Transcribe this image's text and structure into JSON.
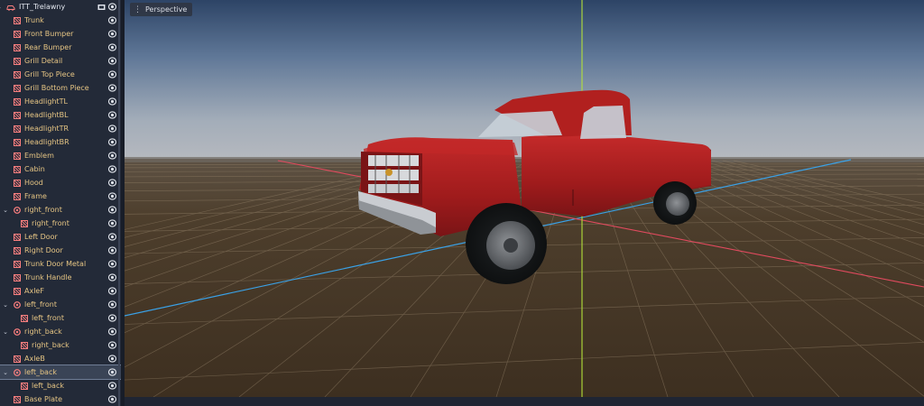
{
  "scene_tree": {
    "root": {
      "label": "ITT_Trelawny",
      "icon": "vehicle-body-icon"
    },
    "nodes": [
      {
        "label": "Trunk",
        "icon": "mesh-instance-icon",
        "depth": 1
      },
      {
        "label": "Front Bumper",
        "icon": "mesh-instance-icon",
        "depth": 1
      },
      {
        "label": "Rear Bumper",
        "icon": "mesh-instance-icon",
        "depth": 1
      },
      {
        "label": "Grill Detail",
        "icon": "mesh-instance-icon",
        "depth": 1
      },
      {
        "label": "Grill Top Piece",
        "icon": "mesh-instance-icon",
        "depth": 1
      },
      {
        "label": "Grill Bottom Piece",
        "icon": "mesh-instance-icon",
        "depth": 1
      },
      {
        "label": "HeadlightTL",
        "icon": "mesh-instance-icon",
        "depth": 1
      },
      {
        "label": "HeadlightBL",
        "icon": "mesh-instance-icon",
        "depth": 1
      },
      {
        "label": "HeadlightTR",
        "icon": "mesh-instance-icon",
        "depth": 1
      },
      {
        "label": "HeadlightBR",
        "icon": "mesh-instance-icon",
        "depth": 1
      },
      {
        "label": "Emblem",
        "icon": "mesh-instance-icon",
        "depth": 1
      },
      {
        "label": "Cabin",
        "icon": "mesh-instance-icon",
        "depth": 1
      },
      {
        "label": "Hood",
        "icon": "mesh-instance-icon",
        "depth": 1
      },
      {
        "label": "Frame",
        "icon": "mesh-instance-icon",
        "depth": 1
      },
      {
        "label": "right_front",
        "icon": "vehicle-wheel-icon",
        "depth": 1,
        "expandable": true
      },
      {
        "label": "right_front",
        "icon": "mesh-instance-icon",
        "depth": 2
      },
      {
        "label": "Left Door",
        "icon": "mesh-instance-icon",
        "depth": 1
      },
      {
        "label": "Right Door",
        "icon": "mesh-instance-icon",
        "depth": 1
      },
      {
        "label": "Trunk Door Metal",
        "icon": "mesh-instance-icon",
        "depth": 1
      },
      {
        "label": "Trunk Handle",
        "icon": "mesh-instance-icon",
        "depth": 1
      },
      {
        "label": "AxleF",
        "icon": "mesh-instance-icon",
        "depth": 1
      },
      {
        "label": "left_front",
        "icon": "vehicle-wheel-icon",
        "depth": 1,
        "expandable": true
      },
      {
        "label": "left_front",
        "icon": "mesh-instance-icon",
        "depth": 2
      },
      {
        "label": "right_back",
        "icon": "vehicle-wheel-icon",
        "depth": 1,
        "expandable": true
      },
      {
        "label": "right_back",
        "icon": "mesh-instance-icon",
        "depth": 2
      },
      {
        "label": "AxleB",
        "icon": "mesh-instance-icon",
        "depth": 1
      },
      {
        "label": "left_back",
        "icon": "vehicle-wheel-icon",
        "depth": 1,
        "expandable": true,
        "selected": true
      },
      {
        "label": "left_back",
        "icon": "mesh-instance-icon",
        "depth": 2
      },
      {
        "label": "Base Plate",
        "icon": "mesh-instance-icon",
        "depth": 1
      }
    ]
  },
  "viewport": {
    "view_menu_label": "Perspective",
    "view_menu_icon": "kebab-menu-icon"
  },
  "colors": {
    "node_label": "#e6c584",
    "mesh_icon": "#fc7f7f",
    "wheel_icon": "#fc7f7f",
    "axis_x": "#e04a5e",
    "axis_y": "#b5e33b",
    "axis_z": "#3f9ee0",
    "truck_body": "#a0191b"
  }
}
